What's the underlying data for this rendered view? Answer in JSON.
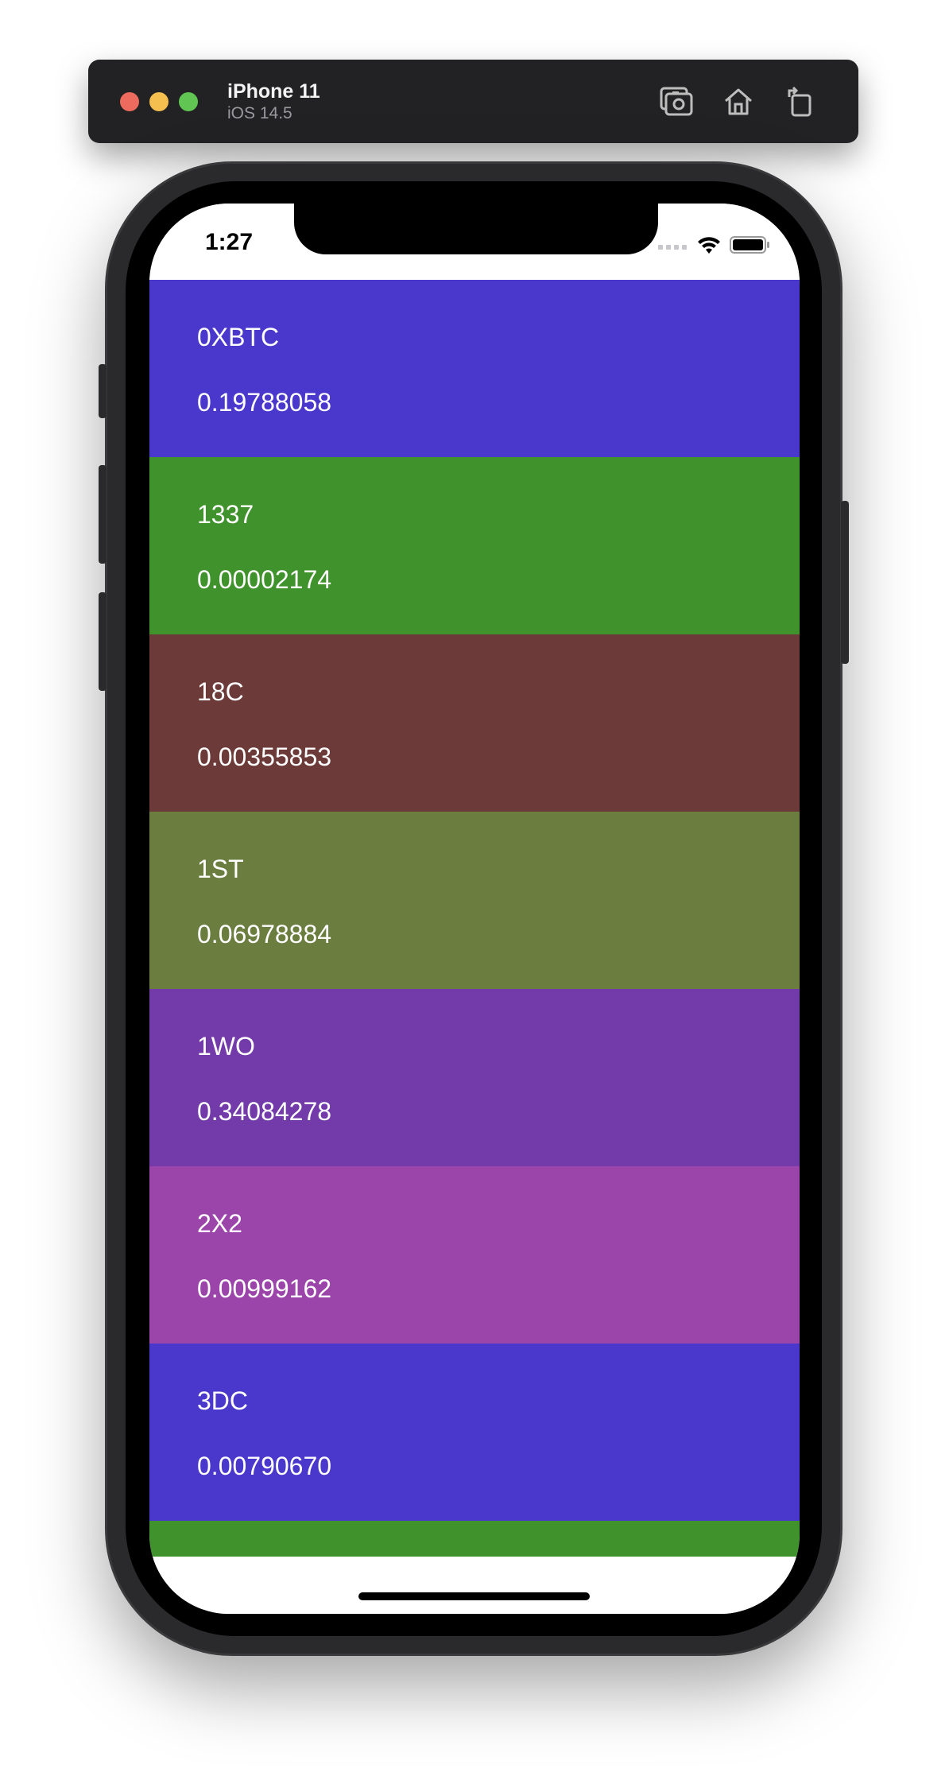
{
  "toolbar": {
    "device_name": "iPhone 11",
    "os_version": "iOS 14.5",
    "icons": [
      "screenshot-icon",
      "home-icon",
      "rotate-icon"
    ]
  },
  "status_bar": {
    "time": "1:27"
  },
  "coins": [
    {
      "symbol": "0XBTC",
      "price": "0.19788058",
      "color": "#4a38cc"
    },
    {
      "symbol": "1337",
      "price": "0.00002174",
      "color": "#40932c"
    },
    {
      "symbol": "18C",
      "price": "0.00355853",
      "color": "#6c3a38"
    },
    {
      "symbol": "1ST",
      "price": "0.06978884",
      "color": "#6b7e40"
    },
    {
      "symbol": "1WO",
      "price": "0.34084278",
      "color": "#733aaa"
    },
    {
      "symbol": "2X2",
      "price": "0.00999162",
      "color": "#9b45aa"
    },
    {
      "symbol": "3DC",
      "price": "0.00790670",
      "color": "#4a38cc"
    },
    {
      "symbol": "",
      "price": "",
      "color": "#40932c"
    }
  ]
}
